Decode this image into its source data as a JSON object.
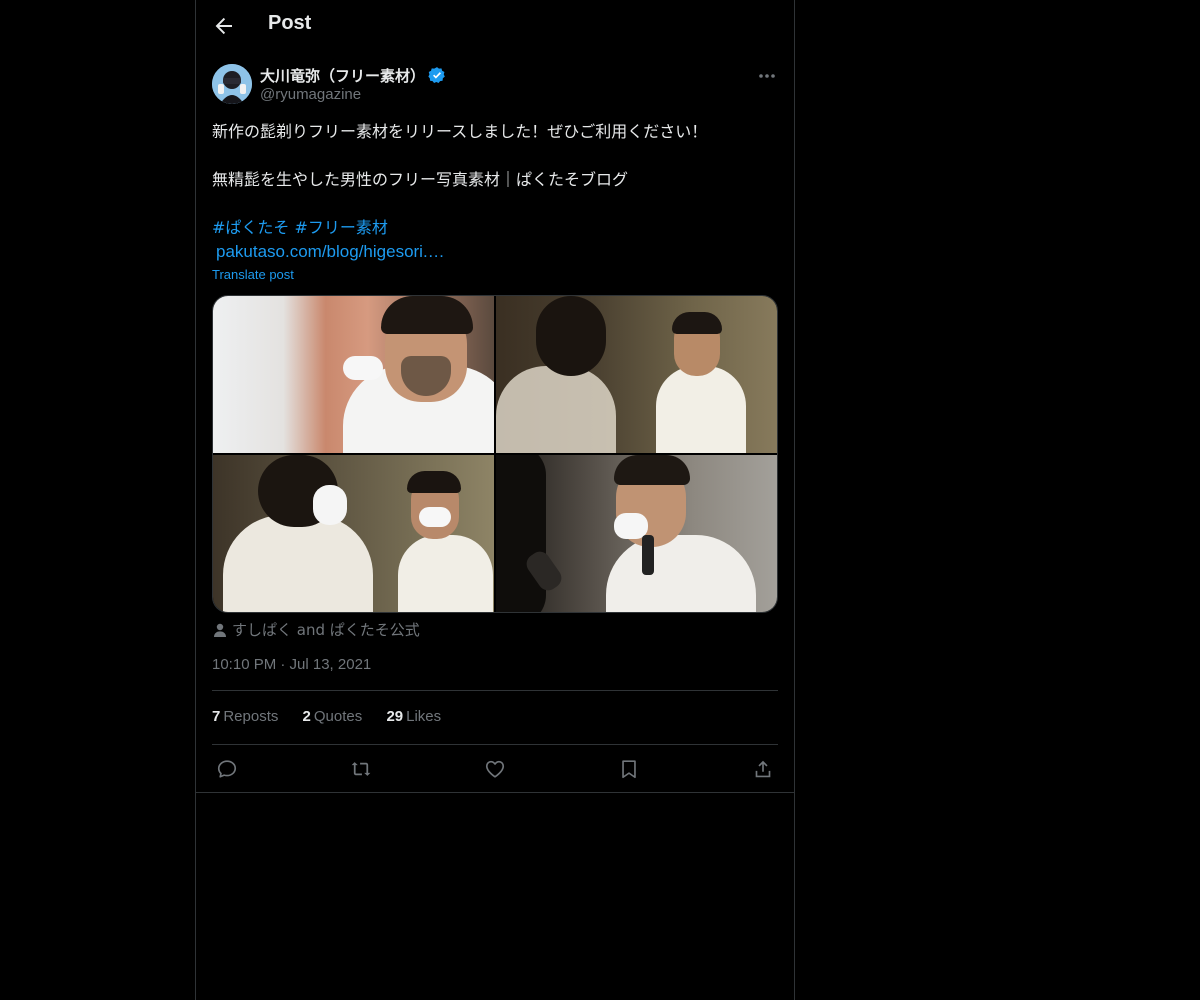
{
  "header": {
    "title": "Post",
    "back_icon": "arrow-left-icon"
  },
  "author": {
    "name": "大川竜弥（フリー素材）",
    "handle": "@ryumagazine",
    "verified_color": "#1d9bf0"
  },
  "post": {
    "lines": [
      "新作の髭剃りフリー素材をリリースしました！ぜひご利用ください！",
      "",
      "無精髭を生やした男性のフリー写真素材｜ぱくたそブログ",
      ""
    ],
    "hashtags": [
      "#ぱくたそ",
      "#フリー素材"
    ],
    "link": "pakutaso.com/blog/higesori.…",
    "translate": "Translate post"
  },
  "media": {
    "photos": [
      "photo-1",
      "photo-2",
      "photo-3",
      "photo-4"
    ]
  },
  "tagged": "すしぱく and ぱくたそ公式",
  "timestamp": "10:10 PM · Jul 13, 2021",
  "stats": {
    "reposts_count": "7",
    "reposts_label": "Reposts",
    "quotes_count": "2",
    "quotes_label": "Quotes",
    "likes_count": "29",
    "likes_label": "Likes"
  },
  "actions": [
    "reply-icon",
    "repost-icon",
    "like-icon",
    "bookmark-icon",
    "share-icon"
  ],
  "colors": {
    "background": "#000000",
    "text": "#e7e9ea",
    "muted": "#71767b",
    "accent": "#1d9bf0",
    "border": "#2f3336"
  }
}
